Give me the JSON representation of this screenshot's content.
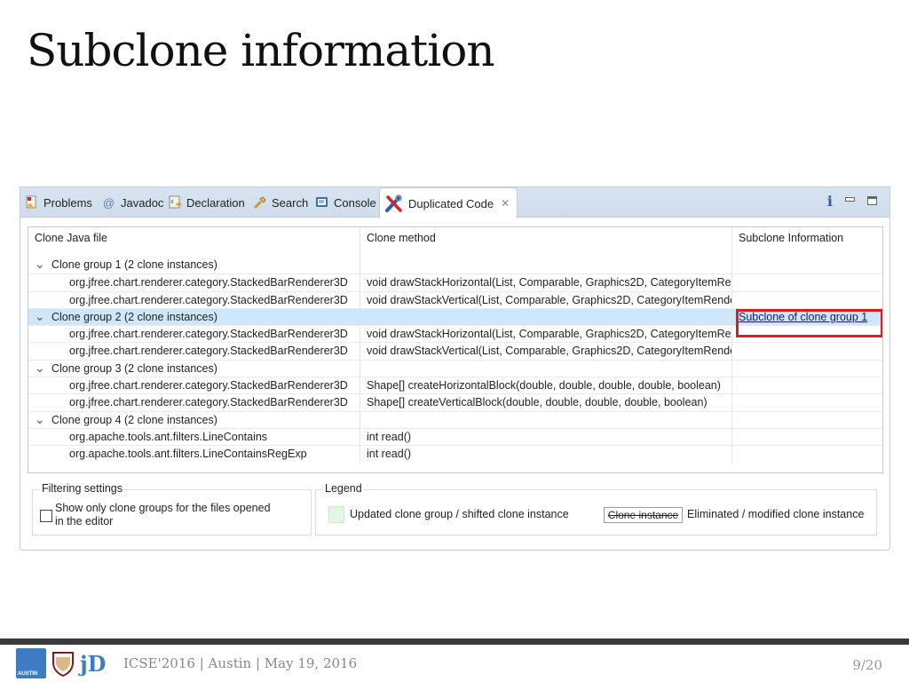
{
  "slide": {
    "title": "Subclone information"
  },
  "view": {
    "tabs": [
      {
        "label": "Problems",
        "icon": "problems-icon"
      },
      {
        "label": "Javadoc",
        "icon": "at-icon"
      },
      {
        "label": "Declaration",
        "icon": "declaration-icon"
      },
      {
        "label": "Search",
        "icon": "search-flashlight-icon"
      },
      {
        "label": "Console",
        "icon": "console-icon"
      },
      {
        "label": "Duplicated Code",
        "icon": "wrench-screwdriver-icon",
        "active": true,
        "close": "✕"
      }
    ],
    "toolbar": {
      "info": "i"
    }
  },
  "table": {
    "headers": [
      "Clone Java file",
      "Clone method",
      "Subclone Information"
    ],
    "rows": [
      {
        "type": "group",
        "file": "Clone group 1 (2 clone instances)",
        "method": "",
        "subclone": ""
      },
      {
        "type": "instance",
        "file": "org.jfree.chart.renderer.category.StackedBarRenderer3D",
        "method": "void drawStackHorizontal(List, Comparable, Graphics2D, CategoryItemRe",
        "subclone": ""
      },
      {
        "type": "instance",
        "file": "org.jfree.chart.renderer.category.StackedBarRenderer3D",
        "method": "void drawStackVertical(List, Comparable, Graphics2D, CategoryItemRende",
        "subclone": ""
      },
      {
        "type": "group",
        "file": "Clone group 2 (2 clone instances)",
        "method": "",
        "subclone": "Subclone of clone group 1",
        "selected": true
      },
      {
        "type": "instance",
        "file": "org.jfree.chart.renderer.category.StackedBarRenderer3D",
        "method": "void drawStackHorizontal(List, Comparable, Graphics2D, CategoryItemRe",
        "subclone": ""
      },
      {
        "type": "instance",
        "file": "org.jfree.chart.renderer.category.StackedBarRenderer3D",
        "method": "void drawStackVertical(List, Comparable, Graphics2D, CategoryItemRende",
        "subclone": ""
      },
      {
        "type": "group",
        "file": "Clone group 3 (2 clone instances)",
        "method": "",
        "subclone": ""
      },
      {
        "type": "instance",
        "file": "org.jfree.chart.renderer.category.StackedBarRenderer3D",
        "method": "Shape[] createHorizontalBlock(double, double, double, double, boolean)",
        "subclone": ""
      },
      {
        "type": "instance",
        "file": "org.jfree.chart.renderer.category.StackedBarRenderer3D",
        "method": "Shape[] createVerticalBlock(double, double, double, double, boolean)",
        "subclone": ""
      },
      {
        "type": "group",
        "file": "Clone group 4 (2 clone instances)",
        "method": "",
        "subclone": ""
      },
      {
        "type": "instance",
        "file": "org.apache.tools.ant.filters.LineContains",
        "method": "int read()",
        "subclone": ""
      },
      {
        "type": "instance",
        "file": "org.apache.tools.ant.filters.LineContainsRegExp",
        "method": "int read()",
        "subclone": ""
      }
    ]
  },
  "filtering": {
    "title": "Filtering settings",
    "checkbox_label_line1": "Show only clone groups for the files opened",
    "checkbox_label_line2": "in the editor",
    "checked": false
  },
  "legend": {
    "title": "Legend",
    "updated_label": "Updated clone group / shifted clone instance",
    "updated_color": "#e2f8e2",
    "clone_instance_sample": "Clone instance",
    "eliminated_label": "Eliminated / modified clone instance"
  },
  "footer": {
    "text": "ICSE'2016 | Austin | May 19, 2016",
    "page": "9/20"
  },
  "colors": {
    "highlight_box": "#e01b1b",
    "selected_row": "#cde8fb"
  }
}
